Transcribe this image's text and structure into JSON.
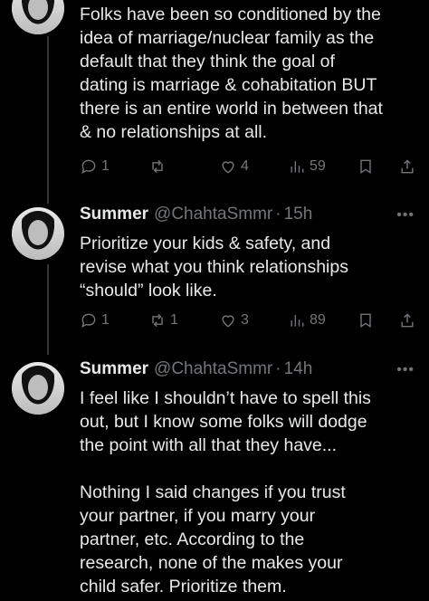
{
  "tweets": [
    {
      "text": "Folks have been so conditioned by the\nidea of marriage/nuclear family as the\ndefault that they think the goal of\ndating is marriage & cohabitation BUT\nthere is an entire world in between that\n& no relationships at all.",
      "replies": "1",
      "reposts": "",
      "likes": "4",
      "views": "59"
    },
    {
      "name": "Summer",
      "handle": "@ChahtaSmmr",
      "time": "15h",
      "text": "Prioritize your kids & safety, and\nrevise what you think relationships\n“should” look like.",
      "replies": "1",
      "reposts": "1",
      "likes": "3",
      "views": "89"
    },
    {
      "name": "Summer",
      "handle": "@ChahtaSmmr",
      "time": "14h",
      "text": "I feel like I shouldn’t have to spell this\nout, but I know some folks will dodge\nthe point with all that they have...\n\nNothing I said changes if you trust\nyour partner, if you marry your\npartner, etc. According to the\nresearch, none of the makes your\nchild safer. Prioritize them."
    }
  ],
  "more_label": "•••",
  "dot": "·",
  "icons": [
    "reply-icon",
    "repost-icon",
    "like-icon",
    "views-icon",
    "bookmark-icon",
    "share-icon"
  ]
}
